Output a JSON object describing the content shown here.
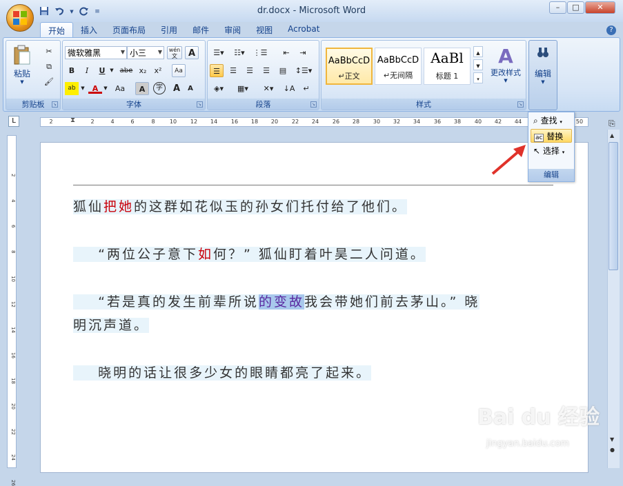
{
  "window": {
    "title": "dr.docx - Microsoft Word"
  },
  "qat": {
    "save_icon": "save-icon",
    "undo_icon": "undo-icon",
    "redo_icon": "redo-icon"
  },
  "tabs": [
    {
      "label": "开始"
    },
    {
      "label": "插入"
    },
    {
      "label": "页面布局"
    },
    {
      "label": "引用"
    },
    {
      "label": "邮件"
    },
    {
      "label": "审阅"
    },
    {
      "label": "视图"
    },
    {
      "label": "Acrobat"
    }
  ],
  "ribbon": {
    "clipboard": {
      "label": "剪贴板",
      "paste": "粘贴"
    },
    "font": {
      "label": "字体",
      "font_name": "微软雅黑",
      "font_size": "小三",
      "wen": "wén\n文",
      "A": "A",
      "bold": "B",
      "italic": "I",
      "underline": "U",
      "strike": "abe",
      "sub": "x₂",
      "sup": "x²",
      "clear": "Aa",
      "highlight": "ab",
      "fontcolor": "A",
      "case": "Aa",
      "shade": "A",
      "circle": "字",
      "grow": "A",
      "shrink": "A"
    },
    "paragraph": {
      "label": "段落"
    },
    "styles": {
      "label": "样式",
      "items": [
        {
          "sample": "AaBbCcD",
          "name": "正文"
        },
        {
          "sample": "AaBbCcD",
          "name": "无间隔"
        },
        {
          "sample": "AaBl",
          "name": "标题 1"
        }
      ],
      "change": "更改样式"
    },
    "editing": {
      "label": "编辑"
    }
  },
  "edit_menu": {
    "find": "查找",
    "replace": "替换",
    "select": "选择",
    "label": "编辑"
  },
  "ruler": {
    "corner": "L",
    "h_numbers": [
      "2",
      "2",
      "4",
      "6",
      "8",
      "10",
      "12",
      "14",
      "16",
      "18",
      "20",
      "22",
      "24",
      "26",
      "28",
      "30",
      "32",
      "34",
      "36",
      "38",
      "40",
      "42",
      "44",
      "50"
    ],
    "v_numbers": [
      "2",
      "4",
      "6",
      "8",
      "10",
      "12",
      "14",
      "16",
      "18",
      "20",
      "22",
      "24",
      "26"
    ]
  },
  "doc": {
    "p1": {
      "a": "狐仙",
      "b": "把她",
      "c": "的这群如花似玉的孙女们托付给了他们。"
    },
    "p2": {
      "a": "    “两位公子意下",
      "b": "如",
      "c": "何？” 狐仙盯着叶昊二人问道。"
    },
    "p3": {
      "a": "    “若是真的发生前辈所说",
      "b": "的变故",
      "c": "我会带她们前去茅山。” 晓",
      "d": "明沉声道。"
    },
    "p4": {
      "a": "    晓明的话让很多少女的眼睛都亮了起来。"
    }
  },
  "watermark": {
    "text": "Bai du 经验",
    "sub": "jingyan.baidu.com"
  }
}
